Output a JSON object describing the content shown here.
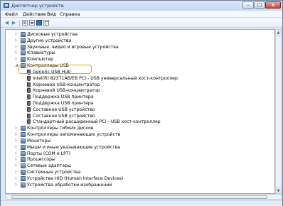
{
  "window": {
    "title": "Диспетчер устройств",
    "minimize": "–",
    "maximize": "□",
    "close": "x"
  },
  "menu": {
    "file": "Файл",
    "action": "Действие",
    "view": "Вид",
    "help": "Справка"
  },
  "toolbar": {
    "back": "◀",
    "forward": "▶"
  },
  "tree": {
    "items": [
      {
        "label": "Дисковые устройства",
        "expander": "▷"
      },
      {
        "label": "Другие устройства",
        "expander": "▷"
      },
      {
        "label": "Звуковые, видео и игровые устройства",
        "expander": "▷"
      },
      {
        "label": "Клавиатуры",
        "expander": "▷"
      },
      {
        "label": "Компьютер",
        "expander": "▷"
      },
      {
        "label": "Контроллеры USB",
        "expander": "◢"
      },
      {
        "label": "Generic USB Hub",
        "expander": ""
      },
      {
        "label": "Intel(R) 82371AB/EB PCI - USB универсальный хост-контроллер",
        "expander": ""
      },
      {
        "label": "Корневой USB-концентратор",
        "expander": ""
      },
      {
        "label": "Корневой USB-концентратор",
        "expander": ""
      },
      {
        "label": "Поддержка USB принтера",
        "expander": ""
      },
      {
        "label": "Поддержка USB принтера",
        "expander": ""
      },
      {
        "label": "Составное USB устройство",
        "expander": ""
      },
      {
        "label": "Составное USB устройство",
        "expander": ""
      },
      {
        "label": "Стандартный расширенный PCI - USB хост-контроллер",
        "expander": ""
      },
      {
        "label": "Контроллеры гибких дисков",
        "expander": "▷"
      },
      {
        "label": "Контроллеры запоминающих устройств",
        "expander": "▷"
      },
      {
        "label": "Мониторы",
        "expander": "▷"
      },
      {
        "label": "Мыши и иные указывающие устройства",
        "expander": "▷"
      },
      {
        "label": "Порты (COM и LPT)",
        "expander": "▷"
      },
      {
        "label": "Процессоры",
        "expander": "▷"
      },
      {
        "label": "Сетевые адаптеры",
        "expander": "▷"
      },
      {
        "label": "Системные устройства",
        "expander": "▷"
      },
      {
        "label": "Устройства HID (Human Interface Devices)",
        "expander": "▷"
      },
      {
        "label": "Устройства обработки изображений",
        "expander": "▷"
      }
    ]
  },
  "scrollbar": {
    "up": "▲",
    "down": "▼"
  }
}
